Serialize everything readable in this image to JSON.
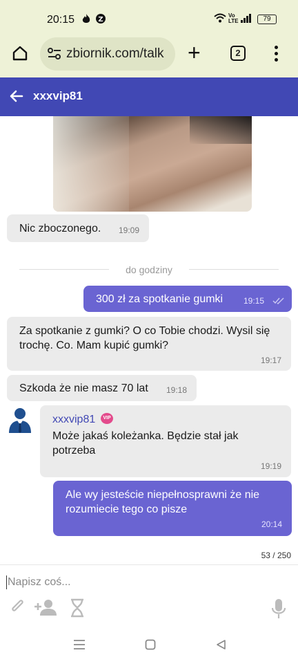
{
  "status_bar": {
    "time": "20:15",
    "battery": "79"
  },
  "browser": {
    "url": "zbiornik.com/talk",
    "tab_count": "2"
  },
  "header": {
    "title": "xxxvip81"
  },
  "messages": [
    {
      "text": "Nic zboczonego.",
      "time": "19:09",
      "dir": "in"
    },
    {
      "text": "300 zł za spotkanie gumki",
      "time": "19:15",
      "dir": "out"
    },
    {
      "text": "Za spotkanie z gumki? O co Tobie chodzi. Wysil się trochę. Co. Mam kupić gumki?",
      "time": "19:17",
      "dir": "in"
    },
    {
      "text": "Szkoda że nie masz 70 lat",
      "time": "19:18",
      "dir": "in"
    },
    {
      "sender": "xxxvip81",
      "badge": "VIP",
      "text": "Może jakaś koleżanka. Będzie stał jak potrzeba",
      "time": "19:19",
      "dir": "in"
    },
    {
      "text": "Ale wy jesteście niepełnosprawni że nie rozumiecie tego co pisze",
      "time": "20:14",
      "dir": "out"
    }
  ],
  "divider": "do godziny",
  "composer": {
    "placeholder": "Napisz coś...",
    "counter": "53 / 250"
  },
  "icons": [
    "home-icon",
    "tune-icon",
    "plus-icon",
    "tabs-icon",
    "more-icon",
    "back-arrow-icon",
    "double-check-icon",
    "user-avatar-icon",
    "attach-icon",
    "add-person-icon",
    "hourglass-icon",
    "microphone-icon",
    "nav-menu-icon",
    "nav-home-icon",
    "nav-back-icon"
  ],
  "colors": {
    "header": "#4148b4",
    "outgoing": "#6a64d2",
    "incoming": "#ebebeb",
    "browser": "#eef2d7"
  }
}
